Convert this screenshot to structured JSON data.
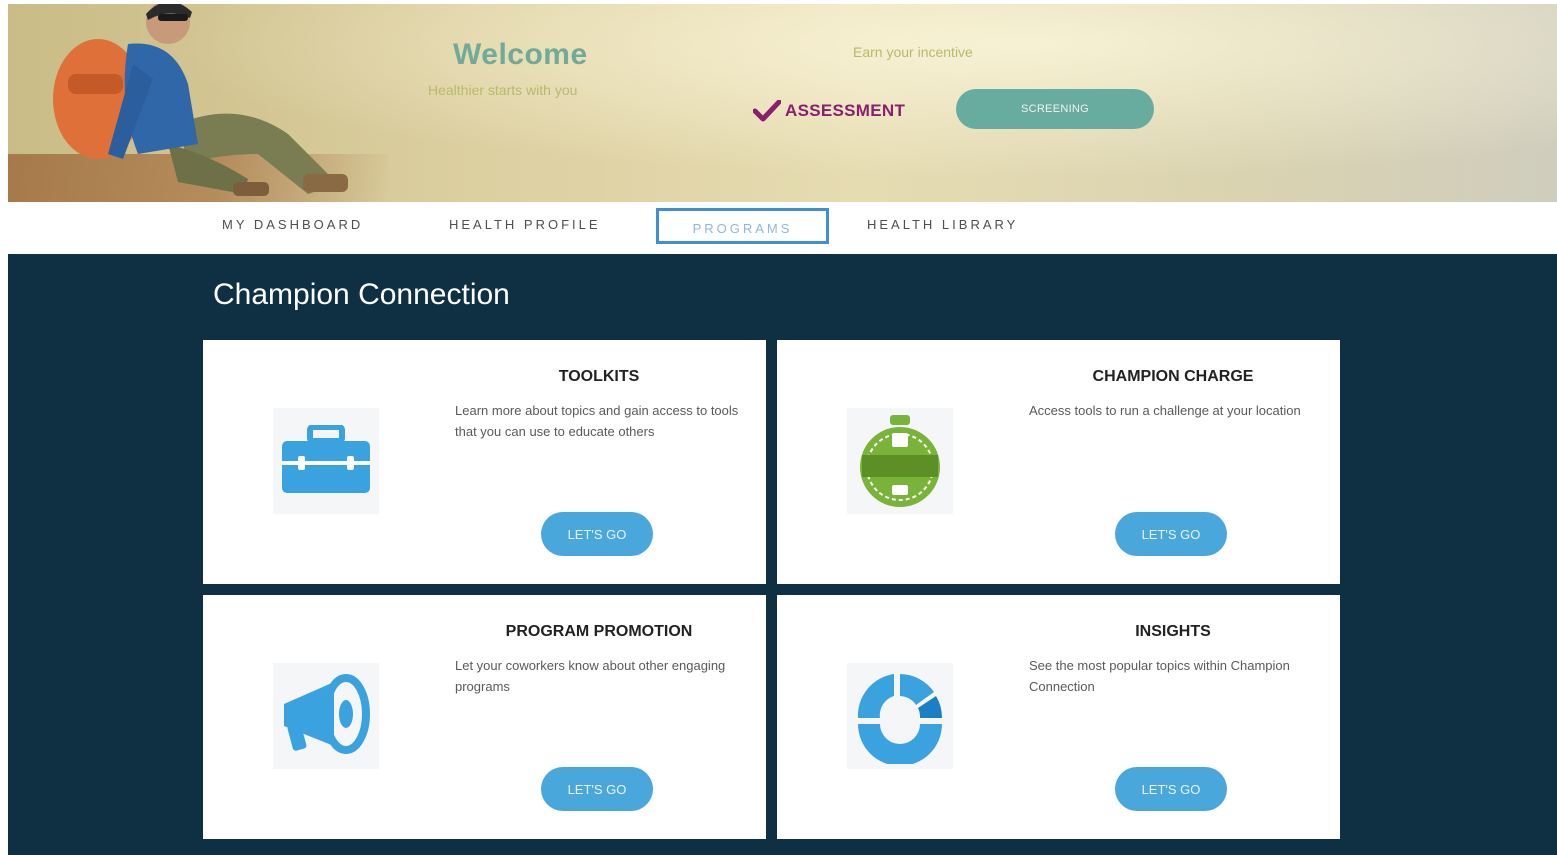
{
  "colors": {
    "nav_active_border": "#3f8fd8",
    "main_background": "#0f2f42",
    "button_blue": "#4aa7dc",
    "screening_button": "#68ab9f",
    "assessment_text": "#8a1f6e",
    "welcome_text": "#6fab98"
  },
  "hero": {
    "welcome": "Welcome",
    "welcome_sub": "Healthier starts with you",
    "earn_text": "Earn your incentive",
    "assessment_label": "ASSESSMENT",
    "screening_label": "SCREENING"
  },
  "nav": {
    "items": [
      {
        "label": "MY DASHBOARD",
        "active": false
      },
      {
        "label": "HEALTH PROFILE",
        "active": false
      },
      {
        "label": "PROGRAMS",
        "active": true
      },
      {
        "label": "HEALTH LIBRARY",
        "active": false
      }
    ]
  },
  "main": {
    "title": "Champion Connection",
    "cards": [
      {
        "title": "TOOLKITS",
        "description": "Learn more about topics and gain access to tools that you can use to educate others",
        "button": "LET'S GO",
        "icon": "toolbox-icon"
      },
      {
        "title": "CHAMPION CHARGE",
        "description": "Access tools to run a challenge at your location",
        "button": "LET'S GO",
        "icon": "champion-charge-logo"
      },
      {
        "title": "PROGRAM PROMOTION",
        "description": "Let your coworkers know about other engaging programs",
        "button": "LET'S GO",
        "icon": "megaphone-icon"
      },
      {
        "title": "INSIGHTS",
        "description": "See the most popular topics within Champion Connection",
        "button": "LET'S GO",
        "icon": "donut-chart-icon"
      }
    ]
  }
}
